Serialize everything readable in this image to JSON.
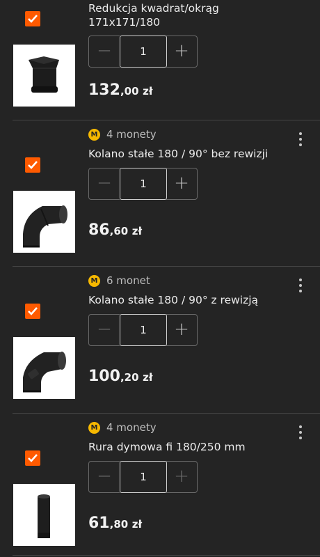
{
  "items": [
    {
      "coins": "",
      "title_line1": "Redukcja kwadrat/okrąg",
      "title_line2": "171x171/180",
      "quantity": "1",
      "minus": "−",
      "plus": "+",
      "price_int": "132",
      "price_dec": ",00",
      "currency": "zł",
      "image": "reduction-square-round"
    },
    {
      "coins": "4 monety",
      "title_line1": "Kolano stałe 180 / 90° bez rewizji",
      "title_line2": "",
      "quantity": "1",
      "minus": "−",
      "plus": "+",
      "price_int": "86",
      "price_dec": ",60",
      "currency": "zł",
      "image": "elbow-90"
    },
    {
      "coins": "6 monet",
      "title_line1": "Kolano stałe 180 / 90° z rewizją",
      "title_line2": "",
      "quantity": "1",
      "minus": "−",
      "plus": "+",
      "price_int": "100",
      "price_dec": ",20",
      "currency": "zł",
      "image": "elbow-90-inspection"
    },
    {
      "coins": "4 monety",
      "title_line1": "Rura dymowa fi 180/250 mm",
      "title_line2": "",
      "quantity": "1",
      "minus": "−",
      "plus": "+",
      "price_int": "61",
      "price_dec": ",80",
      "currency": "zł",
      "image": "smoke-pipe"
    }
  ],
  "coin_letter": "M",
  "colors": {
    "background": "#242424",
    "checkbox": "#ff5a00",
    "coin": "#f6b800",
    "divider": "#474747"
  }
}
